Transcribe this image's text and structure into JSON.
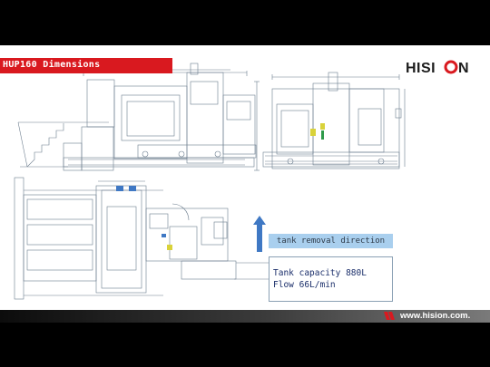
{
  "slide": {
    "title": "HUP160 Dimensions",
    "logo_text": "HISION",
    "direction_label": "tank removal direction",
    "tank_capacity": "Tank capacity 880L",
    "flow": "Flow 66L/min",
    "footer_url": "www.hision.com."
  },
  "colors": {
    "title_bar": "#d9191f",
    "logo_dark": "#1c1c1c",
    "logo_red": "#d9191f",
    "arrow_blue": "#3f78c4",
    "label_blue": "#a9cfee",
    "drawing_line": "#6c7d8e",
    "accent_yellow": "#d9d23a"
  },
  "icons": [
    "up-arrow-icon",
    "footer-mark-icon"
  ]
}
